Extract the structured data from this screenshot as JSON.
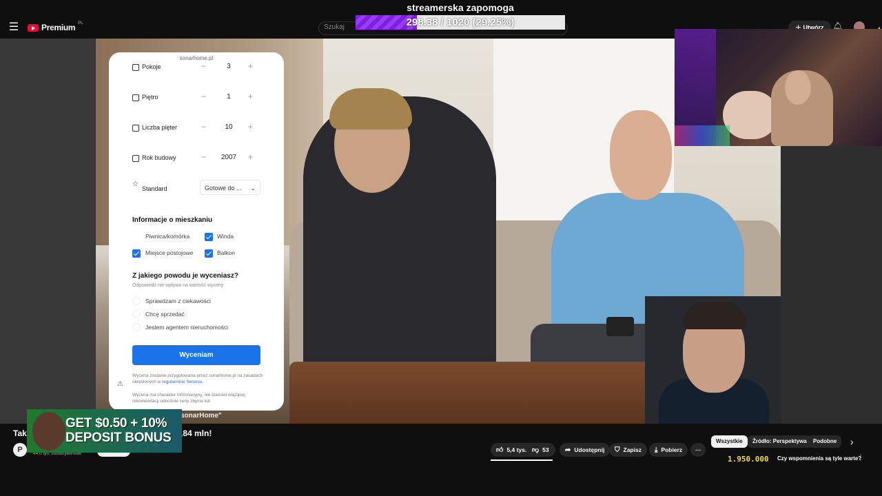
{
  "header": {
    "menu_icon": "hamburger-icon",
    "logo_text": "Premium",
    "logo_region": "PL",
    "search_placeholder": "Szukaj",
    "create_label": "Utwórz",
    "brand_color": "#ff0033"
  },
  "goal": {
    "title": "streamerska zapomoga",
    "progress_text": "298.38 / 1020 (29.25%)",
    "progress": 0.2925,
    "fill_color": "#8a2be2"
  },
  "form": {
    "url": "sonarhome.pl",
    "rows": [
      {
        "label": "Pokoje",
        "value": "3",
        "icon": "bed-icon"
      },
      {
        "label": "Piętro",
        "value": "1",
        "icon": "building-icon"
      },
      {
        "label": "Liczba pięter",
        "value": "10",
        "icon": "building-icon"
      },
      {
        "label": "Rok budowy",
        "value": "2007",
        "icon": "calendar-icon"
      }
    ],
    "standard_label": "Standard",
    "standard_value": "Gotowe do ...",
    "info_title": "Informacje o mieszkaniu",
    "checkboxes": [
      {
        "label": "Piwnica/komórka",
        "checked": false
      },
      {
        "label": "Winda",
        "checked": true
      },
      {
        "label": "Miejsce postojowe",
        "checked": true
      },
      {
        "label": "Balkon",
        "checked": true
      }
    ],
    "reason_title": "Z jakiego powodu je wyceniasz?",
    "reason_sub": "Odpowiedź nie wpływa na wartość wyceny",
    "reasons": [
      "Sprawdzam z ciekawości",
      "Chcę sprzedać",
      "Jestem agentem nieruchomości"
    ],
    "submit_label": "Wyceniam",
    "fine1": "Wycena zostanie przygotowana przez sonarhome.pl na zasadach określonych w",
    "fine1_link": "regulaminie Serwisu.",
    "fine2": "Wycena ma charakter informacyjny, nie stanowi wiążącej rekomendacji odnośnie ceny zbycia lub"
  },
  "ad": {
    "text": "GET $0.50 + 10% DEPOSIT BONUS"
  },
  "video": {
    "title_left": "Tak",
    "title_mid": "sonarHome\"",
    "title_right": ",84 mln!",
    "channel_initial": "P",
    "subscribers": "44,0 tys. subskrybentów"
  },
  "actions": {
    "likes": "5,4 tys.",
    "dislikes": "53",
    "share": "Udostępnij",
    "save": "Zapisz",
    "download": "Pobierz",
    "more": "⋯"
  },
  "chips": [
    "Wszystkie",
    "Źródło: Perspektywa",
    "Podobne"
  ],
  "recommendation": {
    "counter": "1.950.000",
    "title": "Czy wspomnienia są tyle warte?"
  }
}
